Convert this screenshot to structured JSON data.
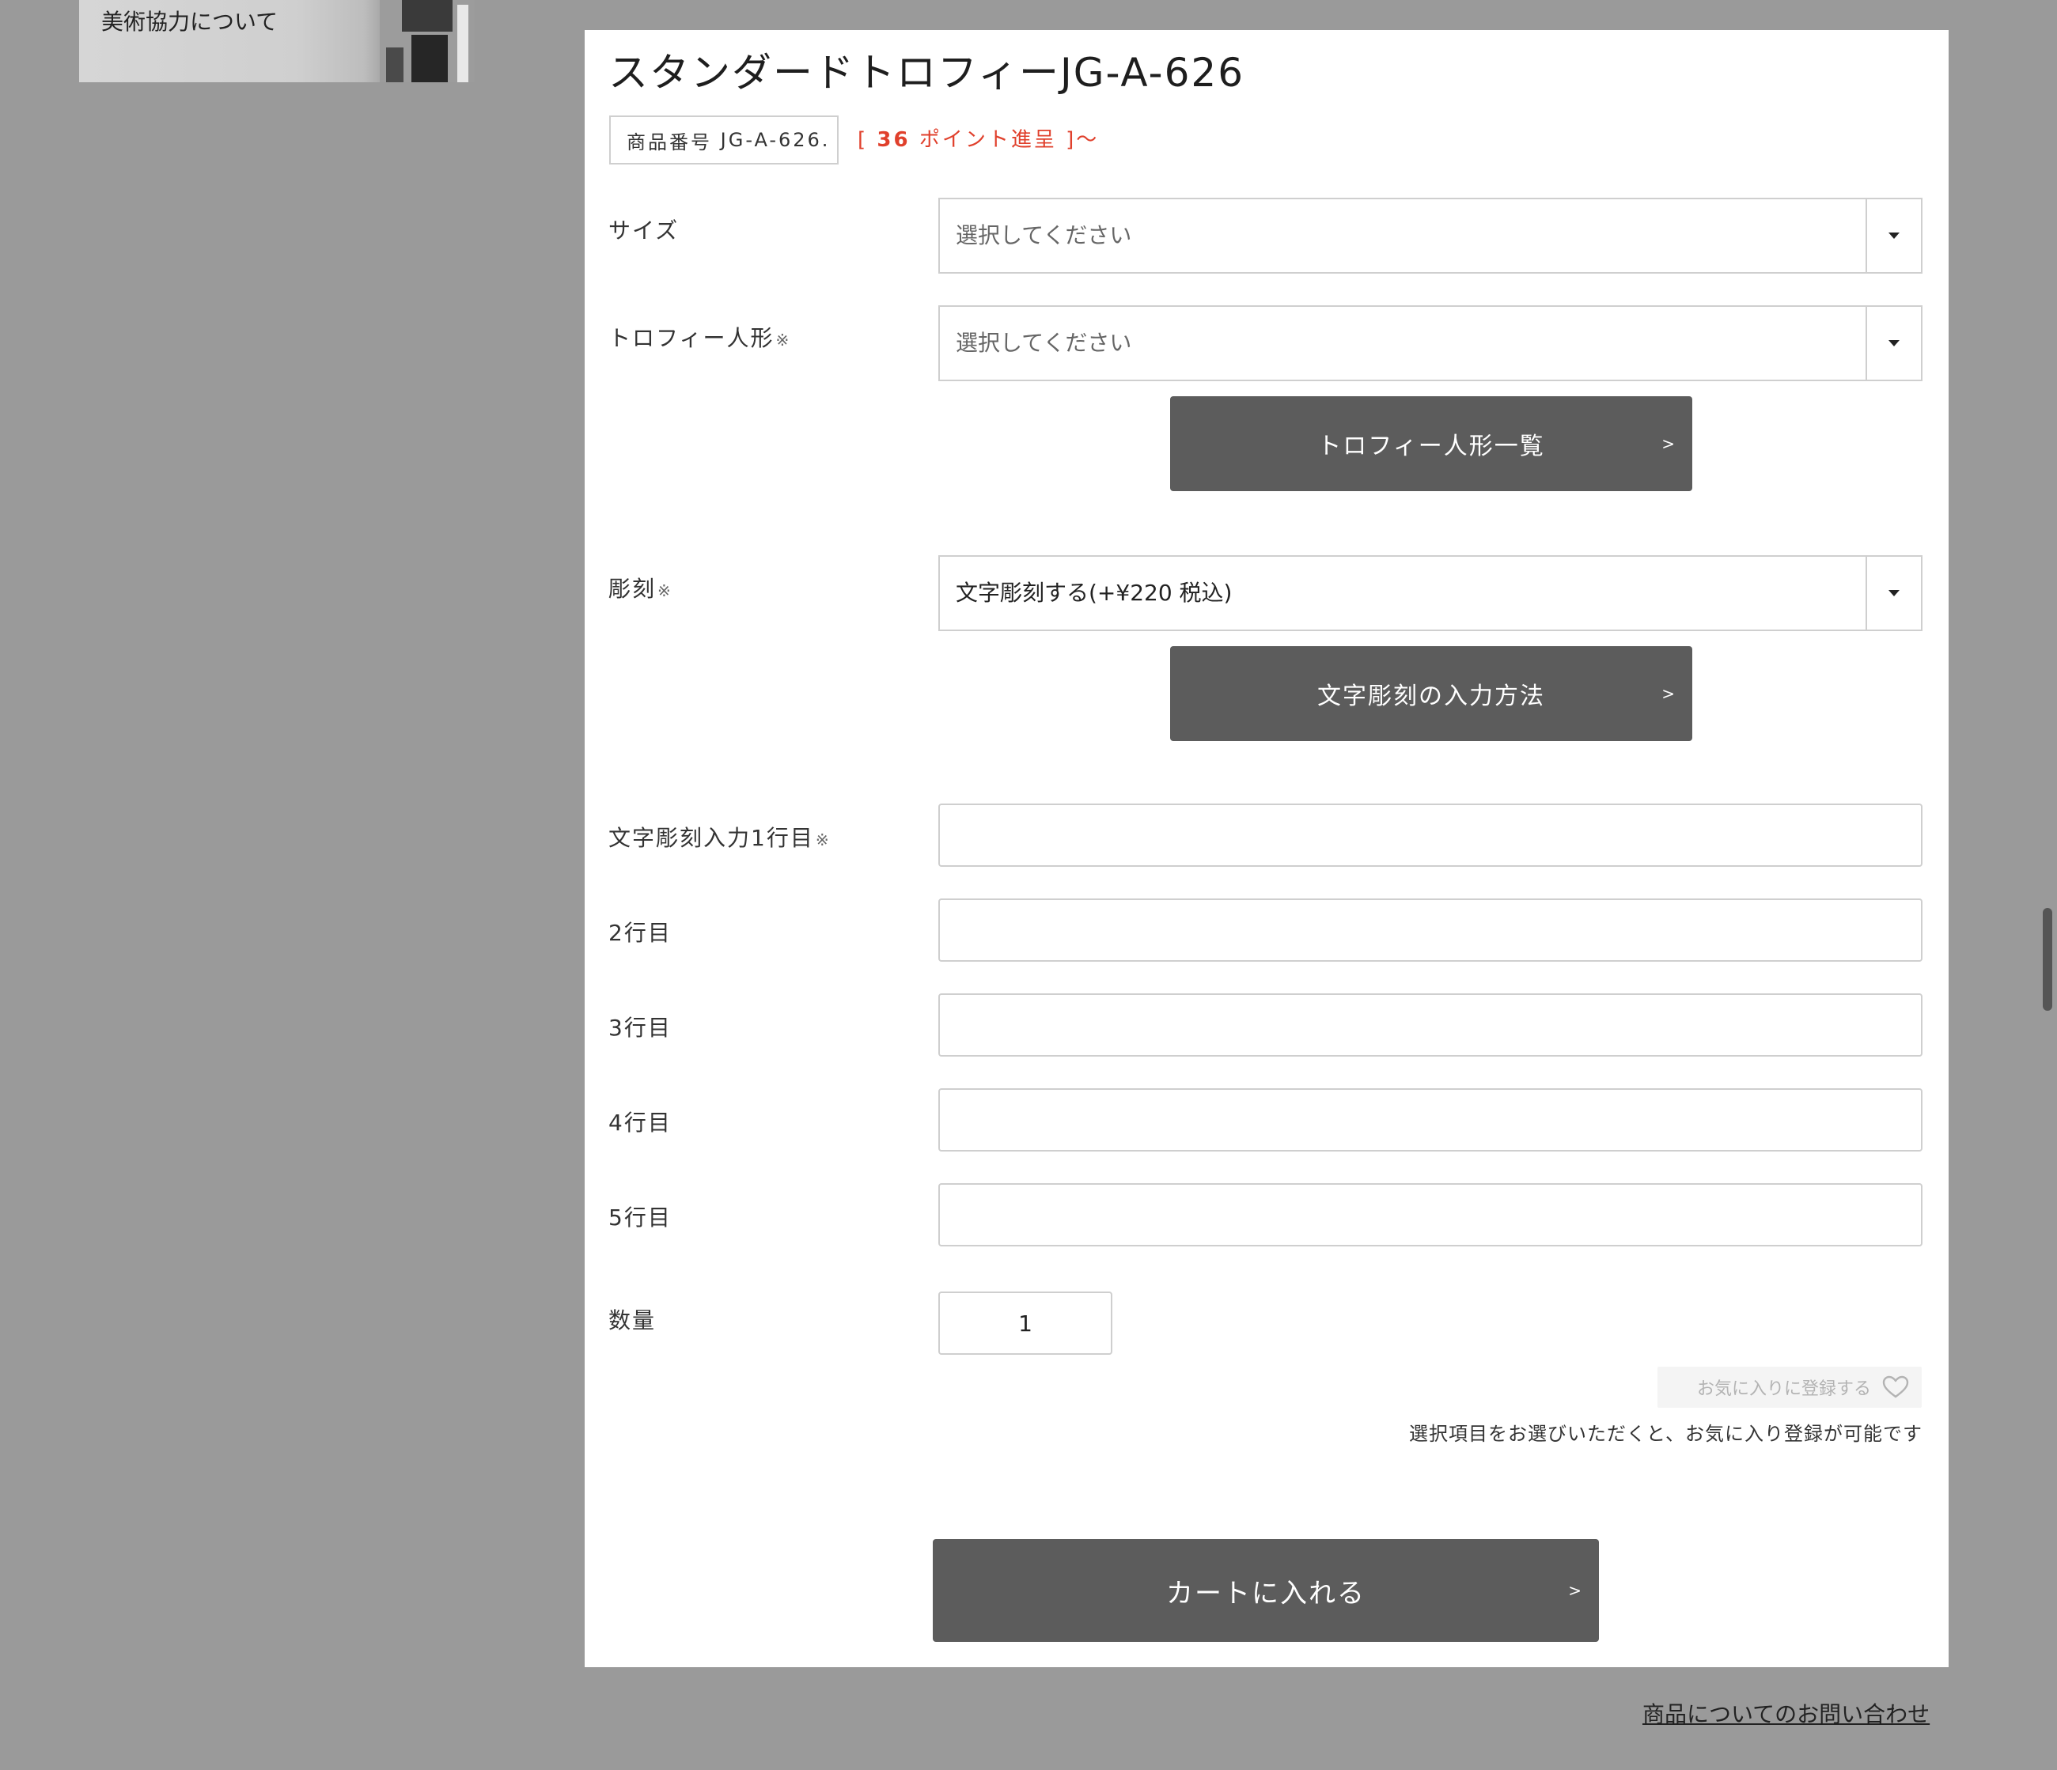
{
  "sidebar": {
    "banner_label": "美術協力について"
  },
  "product": {
    "title": "スタンダードトロフィーJG-A-626",
    "sku_label": "商品番号",
    "sku_value": "JG-A-626.",
    "points_open": "[",
    "points_number": "36",
    "points_text": "ポイント進呈",
    "points_close": "]〜"
  },
  "form": {
    "required_mark": "※",
    "size": {
      "label": "サイズ",
      "value": "選択してください"
    },
    "figure": {
      "label": "トロフィー人形",
      "value": "選択してください",
      "list_button": "トロフィー人形一覧"
    },
    "engraving": {
      "label": "彫刻",
      "value": "文字彫刻する(+¥220 税込)",
      "howto_button": "文字彫刻の入力方法"
    },
    "lines": [
      {
        "label": "文字彫刻入力1行目",
        "value": ""
      },
      {
        "label": "2行目",
        "value": ""
      },
      {
        "label": "3行目",
        "value": ""
      },
      {
        "label": "4行目",
        "value": ""
      },
      {
        "label": "5行目",
        "value": ""
      }
    ],
    "quantity": {
      "label": "数量",
      "value": "1"
    }
  },
  "favorite": {
    "button_label": "お気に入りに登録する",
    "icon": "heart-outline-icon",
    "note": "選択項目をお選びいただくと、お気に入り登録が可能です"
  },
  "cart": {
    "button_label": "カートに入れる",
    "arrow": ">"
  },
  "contact_link": "商品についてのお問い合わせ",
  "colors": {
    "page_background": "#9a9a9a",
    "button_dark": "#5c5c5c",
    "points_accent": "#e0402c",
    "border": "#cfcfcf"
  }
}
